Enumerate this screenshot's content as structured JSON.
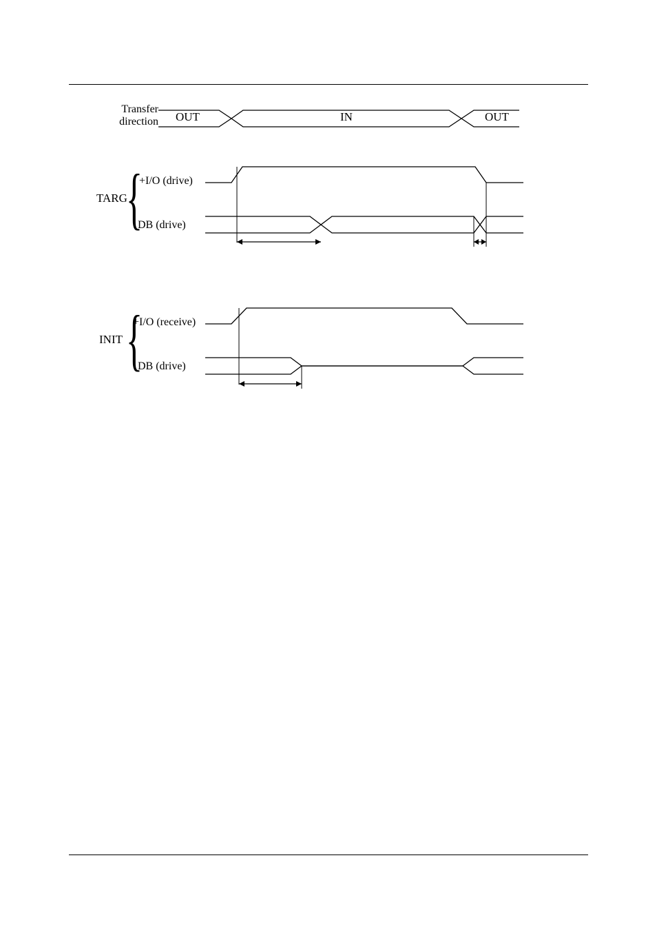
{
  "header": {
    "running_left": "",
    "running_right": ""
  },
  "diagram": {
    "transfer_label_1": "Transfer",
    "transfer_label_2": "direction",
    "state_out_1": "OUT",
    "state_in": "IN",
    "state_out_2": "OUT",
    "targ_label": "TARG",
    "targ_sig1": "+I/O (drive)",
    "targ_sig2": "DB (drive)",
    "init_label": "INIT",
    "init_sig1": "+I/O (receive)",
    "init_sig2": "DB (drive)"
  },
  "footer": {
    "page_number": "",
    "doc_id": ""
  }
}
